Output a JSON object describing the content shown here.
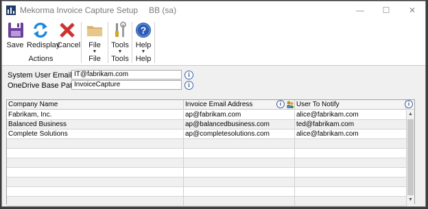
{
  "window": {
    "title": "Mekorma Invoice Capture Setup",
    "context": "BB (sa)",
    "minimize": "—",
    "maximize": "☐",
    "close": "✕"
  },
  "ribbon": {
    "actions": {
      "label": "Actions",
      "save": "Save",
      "redisplay": "Redisplay",
      "cancel": "Cancel"
    },
    "file": {
      "label": "File",
      "button": "File"
    },
    "tools": {
      "label": "Tools",
      "button": "Tools"
    },
    "help": {
      "label": "Help",
      "button": "Help"
    },
    "dropdown_arrow": "▼"
  },
  "form": {
    "system_user_email": {
      "label": "System User Email",
      "value": "IT@fabrikam.com"
    },
    "onedrive_base_path": {
      "label": "OneDrive Base Path",
      "value": "InvoiceCapture"
    },
    "info_glyph": "i"
  },
  "grid": {
    "columns": [
      "Company Name",
      "Invoice Email Address",
      "User To Notify"
    ],
    "rows": [
      [
        "Fabrikam, Inc.",
        "ap@fabrikam.com",
        "alice@fabrikam.com"
      ],
      [
        "Balanced Business",
        "ap@balancedbusiness.com",
        "ted@fabrikam.com"
      ],
      [
        "Complete Solutions",
        "ap@completesolutions.com",
        "alice@fabrikam.com"
      ],
      [
        "",
        "",
        ""
      ],
      [
        "",
        "",
        ""
      ],
      [
        "",
        "",
        ""
      ],
      [
        "",
        "",
        ""
      ],
      [
        "",
        "",
        ""
      ],
      [
        "",
        "",
        ""
      ],
      [
        "",
        "",
        ""
      ]
    ],
    "scroll_up": "▲",
    "scroll_down": "▼"
  },
  "colors": {
    "save_icon": "#6b3fa0",
    "redisplay_icon": "#1e88e5",
    "cancel_icon": "#d32f2f",
    "file_icon": "#d8b36a",
    "help_icon": "#2b5cb8"
  }
}
